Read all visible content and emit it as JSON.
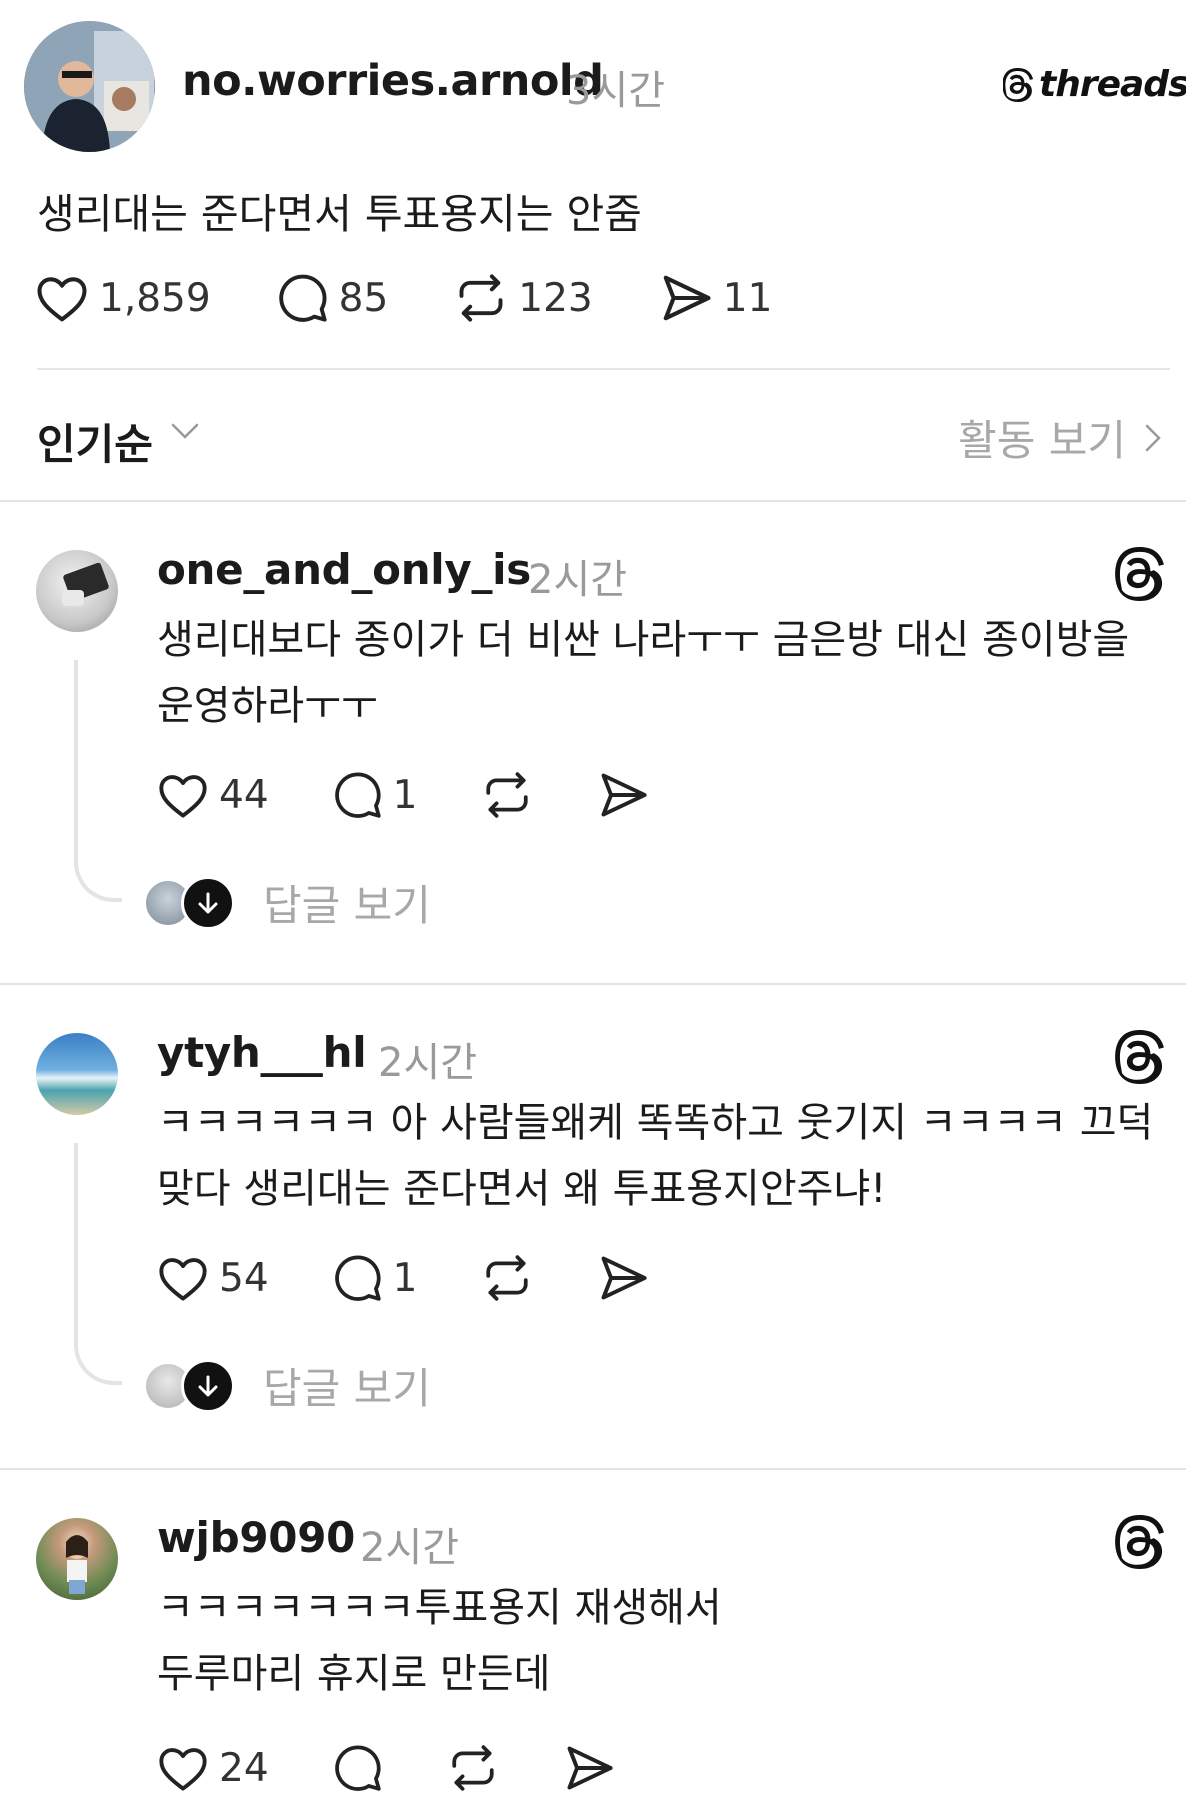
{
  "post": {
    "username": "no.worries.arnold",
    "time": "3시간",
    "brand": "threads",
    "body": "생리대는 준다면서 투표용지는 안줌",
    "likes": "1,859",
    "comments": "85",
    "reposts": "123",
    "shares": "11"
  },
  "sort": {
    "label": "인기순",
    "activity_label": "활동 보기"
  },
  "replies": [
    {
      "username": "one_and_only_is",
      "time": "2시간",
      "text": "생리대보다 종이가 더 비싼 나라ㅜㅜ 금은방 대신 종이방을 운영하라ㅜㅜ",
      "likes": "44",
      "comments": "1",
      "view_replies": "답글 보기"
    },
    {
      "username": "ytyh___hl",
      "time": "2시간",
      "text": "ㅋㅋㅋㅋㅋㅋ 아 사람들왜케 똑똑하고 웃기지 ㅋㅋㅋㅋ 끄덕 맞다 생리대는 준다면서 왜 투표용지안주냐!",
      "likes": "54",
      "comments": "1",
      "view_replies": "답글 보기"
    },
    {
      "username": "wjb9090",
      "time": "2시간",
      "text_line1": "ㅋㅋㅋㅋㅋㅋㅋ투표용지 재생해서",
      "text_line2": "두루마리 휴지로 만든데",
      "likes": "24"
    }
  ],
  "colors": {
    "text": "#1b1b1b",
    "muted": "#9a9a9a",
    "divider": "#e4e4e4"
  }
}
